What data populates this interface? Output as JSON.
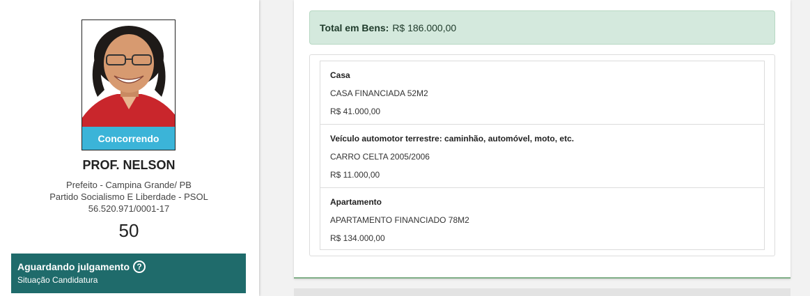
{
  "candidate": {
    "badge": "Concorrendo",
    "name": "PROF. NELSON",
    "office": "Prefeito - Campina Grande/ PB",
    "party": "Partido Socialismo E Liberdade - PSOL",
    "cnpj": "56.520.971/0001-17",
    "number": "50"
  },
  "status": {
    "title": "Aguardando julgamento",
    "subtitle": "Situação Candidatura"
  },
  "assets": {
    "total_label": "Total em Bens:",
    "total_value": "R$ 186.000,00",
    "items": [
      {
        "type": "Casa",
        "description": "CASA FINANCIADA 52M2",
        "value": "R$ 41.000,00"
      },
      {
        "type": "Veículo automotor terrestre: caminhão, automóvel, moto, etc.",
        "description": "CARRO CELTA 2005/2006",
        "value": "R$ 11.000,00"
      },
      {
        "type": "Apartamento",
        "description": "APARTAMENTO FINANCIADO 78M2",
        "value": "R$ 134.000,00"
      }
    ]
  },
  "colors": {
    "badge": "#3bb4d8",
    "status_bg": "#1f6b6b",
    "total_bg": "#d4e9dd"
  }
}
